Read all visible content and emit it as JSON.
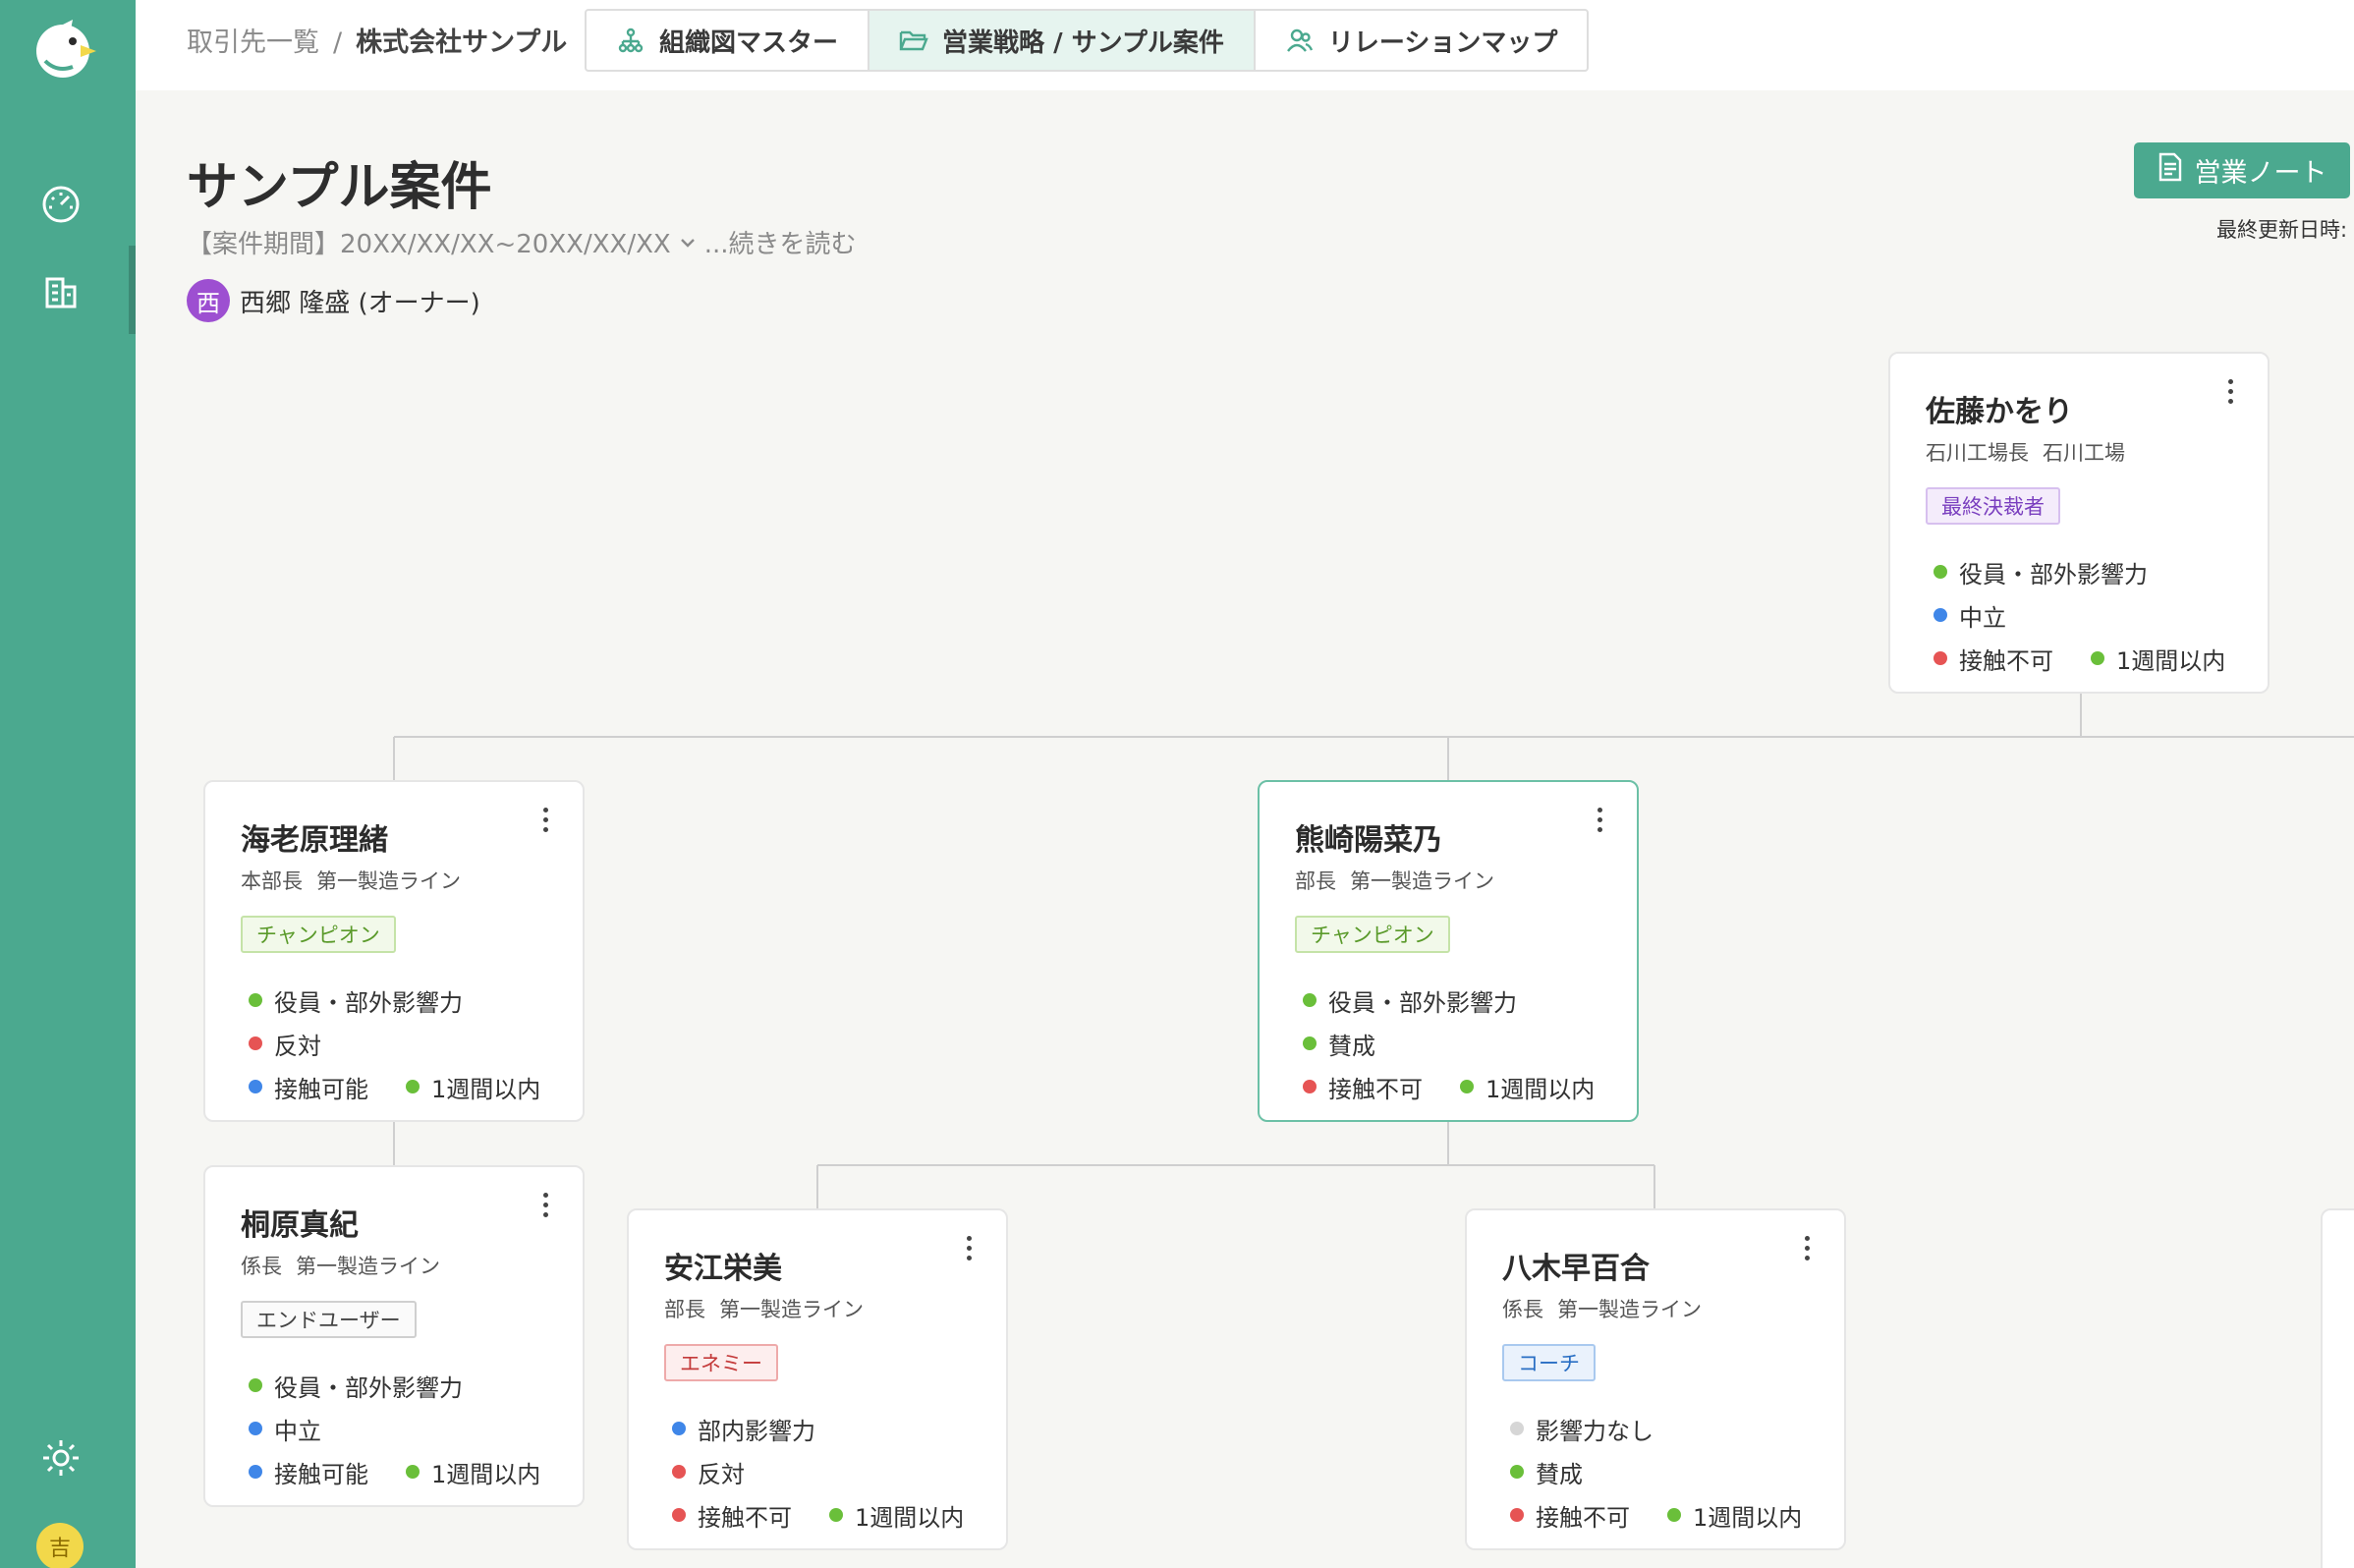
{
  "breadcrumb": {
    "parent": "取引先一覧",
    "separator": "/",
    "current": "株式会社サンプル"
  },
  "tabs": [
    {
      "label": "組織図マスター",
      "icon": "org-chart-icon",
      "active": false
    },
    {
      "label": "営業戦略 / サンプル案件",
      "icon": "folder-open-icon",
      "active": true
    },
    {
      "label": "リレーションマップ",
      "icon": "people-icon",
      "active": false
    }
  ],
  "header": {
    "title": "サンプル案件",
    "period": "【案件期間】20XX/XX/XX~20XX/XX/XX",
    "read_more": "...続きを読む",
    "owner_initial": "西",
    "owner_name": "西郷 隆盛 (オーナー)",
    "note_button": "営業ノート",
    "last_updated_label": "最終更新日時:"
  },
  "sidebar": {
    "items": [
      {
        "icon": "dashboard-gauge-icon"
      },
      {
        "icon": "building-icon"
      },
      {
        "icon": "gear-icon"
      }
    ],
    "user_initial": "吉"
  },
  "colors": {
    "brand": "#4ba98f",
    "influence_high": "#6abf3a",
    "neutral": "#3f86e8",
    "negative": "#e65454",
    "none": "#d6d6d6"
  },
  "cards": [
    {
      "name": "佐藤かをり",
      "title": "石川工場長",
      "department": "石川工場",
      "tag": "最終決裁者",
      "tag_color": "purple",
      "influence": "役員・部外影響力",
      "influence_color": "green",
      "stance": "中立",
      "stance_color": "blue",
      "contact": "接触不可",
      "contact_color": "red",
      "recency": "1週間以内",
      "recency_color": "green"
    },
    {
      "name": "海老原理緒",
      "title": "本部長",
      "department": "第一製造ライン",
      "tag": "チャンピオン",
      "tag_color": "green",
      "influence": "役員・部外影響力",
      "influence_color": "green",
      "stance": "反対",
      "stance_color": "red",
      "contact": "接触可能",
      "contact_color": "blue",
      "recency": "1週間以内",
      "recency_color": "green"
    },
    {
      "name": "熊崎陽菜乃",
      "title": "部長",
      "department": "第一製造ライン",
      "tag": "チャンピオン",
      "tag_color": "green",
      "influence": "役員・部外影響力",
      "influence_color": "green",
      "stance": "賛成",
      "stance_color": "green",
      "contact": "接触不可",
      "contact_color": "red",
      "recency": "1週間以内",
      "recency_color": "green"
    },
    {
      "name": "桐原真紀",
      "title": "係長",
      "department": "第一製造ライン",
      "tag": "エンドユーザー",
      "tag_color": "gray",
      "influence": "役員・部外影響力",
      "influence_color": "green",
      "stance": "中立",
      "stance_color": "blue",
      "contact": "接触可能",
      "contact_color": "blue",
      "recency": "1週間以内",
      "recency_color": "green"
    },
    {
      "name": "安江栄美",
      "title": "部長",
      "department": "第一製造ライン",
      "tag": "エネミー",
      "tag_color": "red",
      "influence": "部内影響力",
      "influence_color": "blue",
      "stance": "反対",
      "stance_color": "red",
      "contact": "接触不可",
      "contact_color": "red",
      "recency": "1週間以内",
      "recency_color": "green"
    },
    {
      "name": "八木早百合",
      "title": "係長",
      "department": "第一製造ライン",
      "tag": "コーチ",
      "tag_color": "blue",
      "influence": "影響力なし",
      "influence_color": "gray",
      "stance": "賛成",
      "stance_color": "green",
      "contact": "接触不可",
      "contact_color": "red",
      "recency": "1週間以内",
      "recency_color": "green"
    }
  ]
}
